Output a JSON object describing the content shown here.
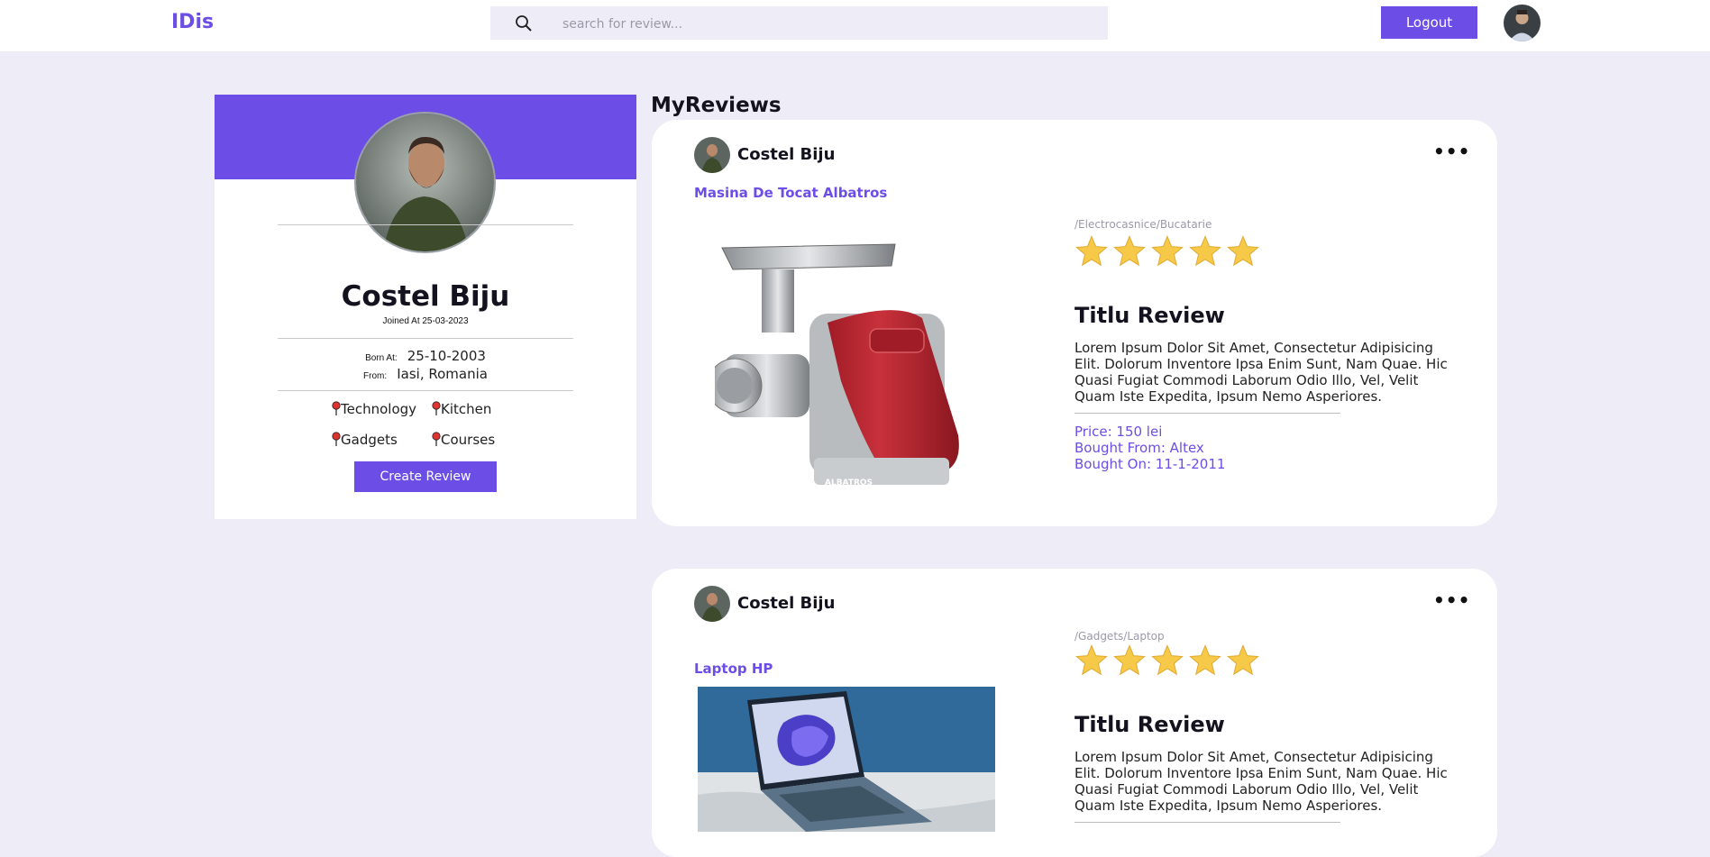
{
  "header": {
    "logo": "IDis",
    "search_placeholder": "search for review...",
    "logout_label": "Logout"
  },
  "profile": {
    "name": "Costel Biju",
    "joined": "Joined At 25-03-2023",
    "born_label": "Born At:",
    "born_value": "25-10-2003",
    "from_label": "From:",
    "from_value": "Iasi, Romania",
    "interests": [
      "Technology",
      "Kitchen",
      "Gadgets",
      "Courses"
    ],
    "create_label": "Create Review"
  },
  "reviews_title": "MyReviews",
  "reviews": [
    {
      "author": "Costel Biju",
      "product": "Masina De Tocat Albatros",
      "category": "/Electrocasnice/Bucatarie",
      "rating": 5,
      "title": "Titlu Review",
      "body": "Lorem Ipsum Dolor Sit Amet, Consectetur Adipisicing Elit. Dolorum Inventore Ipsa Enim Sunt, Nam Quae. Hic Quasi Fugiat Commodi Laborum Odio Illo, Vel, Velit Quam Iste Expedita, Ipsum Nemo Asperiores.",
      "price": "Price: 150 lei",
      "bought_from": "Bought From: Altex",
      "bought_on": "Bought On: 11-1-2011",
      "brand_mark": "ALBATROS"
    },
    {
      "author": "Costel Biju",
      "product": "Laptop HP",
      "category": "/Gadgets/Laptop",
      "rating": 5,
      "title": "Titlu Review",
      "body": "Lorem Ipsum Dolor Sit Amet, Consectetur Adipisicing Elit. Dolorum Inventore Ipsa Enim Sunt, Nam Quae. Hic Quasi Fugiat Commodi Laborum Odio Illo, Vel, Velit Quam Iste Expedita, Ipsum Nemo Asperiores."
    }
  ],
  "colors": {
    "accent": "#6c4ee6",
    "background": "#eeedf7",
    "star": "#f7c948"
  }
}
